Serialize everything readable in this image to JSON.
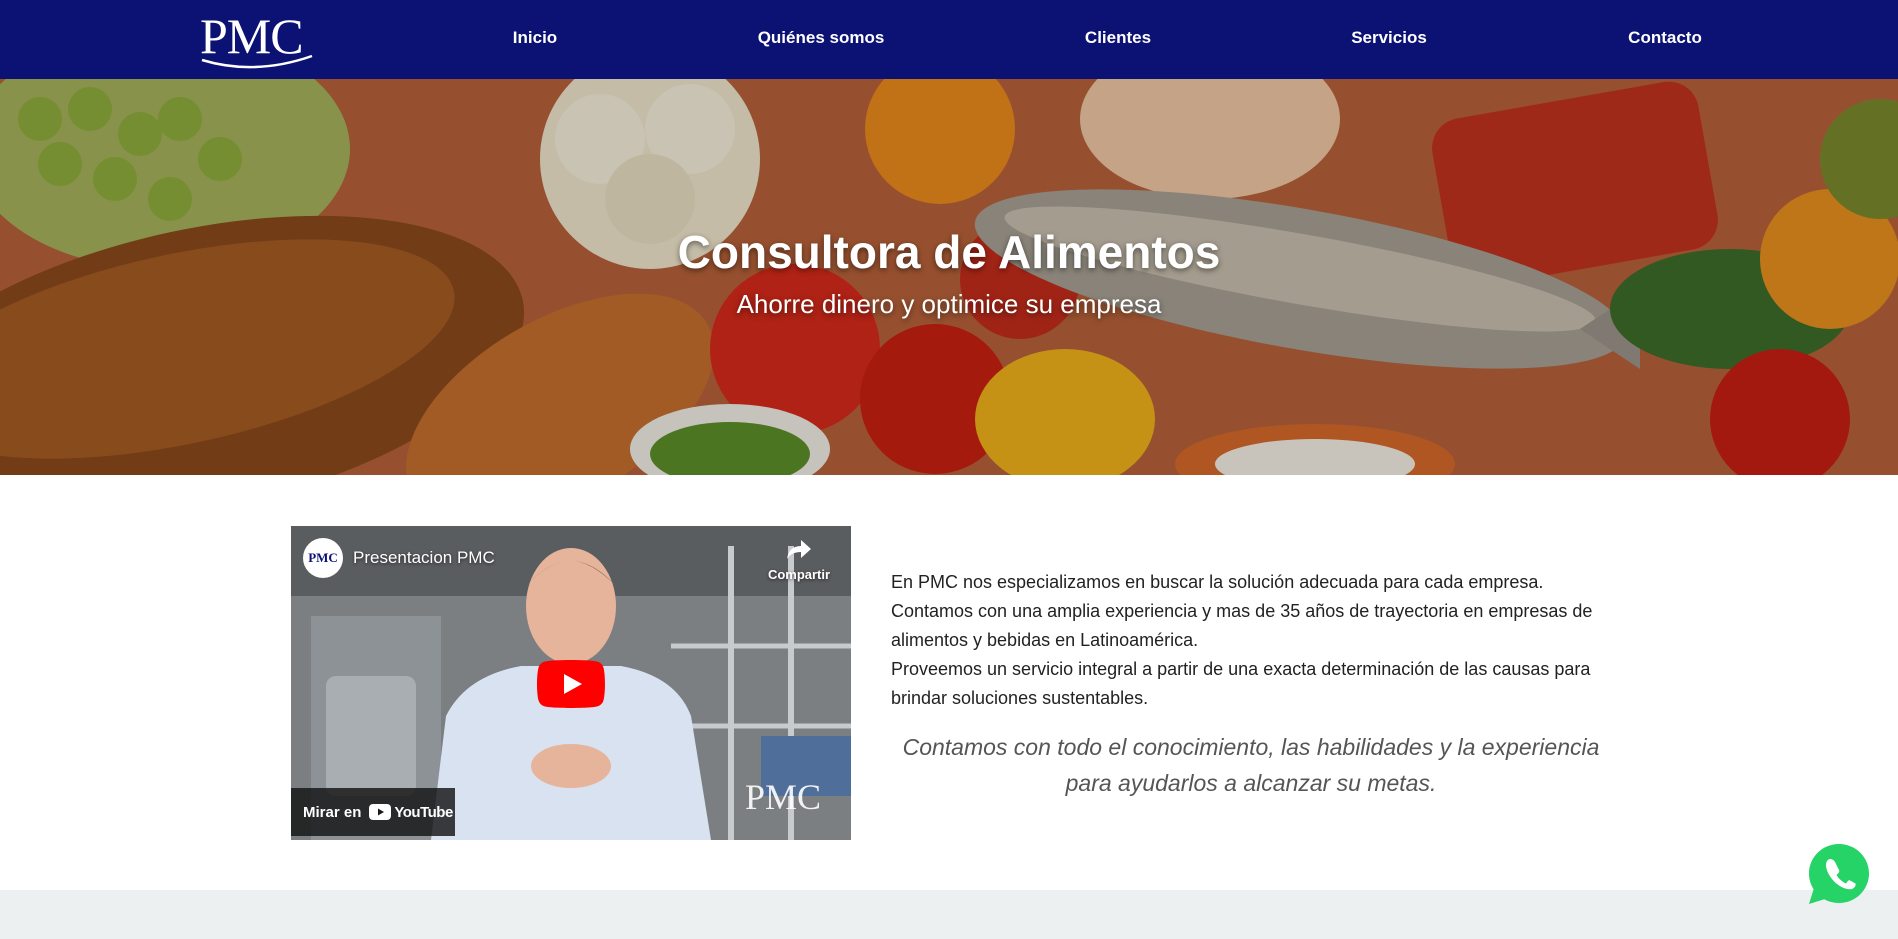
{
  "brand": {
    "logo_text": "PMC"
  },
  "nav": {
    "items": [
      {
        "label": "Inicio"
      },
      {
        "label": "Quiénes somos"
      },
      {
        "label": "Clientes"
      },
      {
        "label": "Servicios"
      },
      {
        "label": "Contacto"
      }
    ]
  },
  "hero": {
    "title": "Consultora de Alimentos",
    "subtitle": "Ahorre dinero y optimice su empresa"
  },
  "video": {
    "channel_avatar_text": "PMC",
    "title": "Presentacion PMC",
    "share_label": "Compartir",
    "watch_label": "Mirar en",
    "youtube_label": "YouTube",
    "watermark": "PMC"
  },
  "about": {
    "paragraphs": [
      "En PMC nos especializamos en buscar la solución adecuada para cada empresa.",
      "Contamos con una amplia experiencia y mas de 35 años de trayectoria en empresas de alimentos y bebidas en Latinoamérica.",
      "Proveemos un servicio integral a partir de una exacta determinación de las causas para brindar soluciones sustentables."
    ],
    "quote": "Contamos con todo el conocimiento, las habilidades y la experiencia para ayudarlos a alcanzar su metas."
  },
  "colors": {
    "nav_bg": "#0b1274",
    "strip_bg": "#edf0f1",
    "youtube_red": "#ff0000",
    "whatsapp_green": "#25d366"
  },
  "icons": {
    "share": "share-arrow-icon",
    "play": "youtube-play-icon",
    "whatsapp": "whatsapp-icon"
  }
}
